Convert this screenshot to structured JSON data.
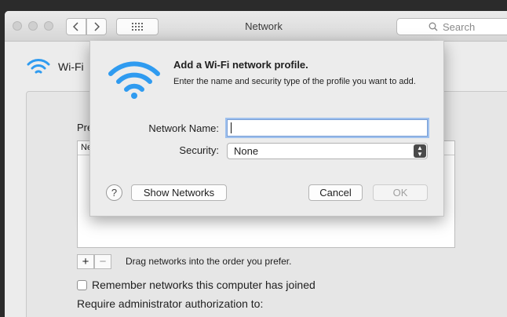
{
  "window": {
    "title": "Network"
  },
  "toolbar": {
    "search_placeholder": "Search"
  },
  "sidebar": {
    "wifi_label": "Wi-Fi"
  },
  "panel": {
    "preferred_label": "Pre",
    "list_header": "Ne",
    "drag_hint": "Drag networks into the order you prefer.",
    "plus_label": "+",
    "minus_label": "−",
    "remember_label": "Remember networks this computer has joined",
    "require_label": "Require administrator authorization to:"
  },
  "dialog": {
    "title": "Add a Wi-Fi network profile.",
    "description": "Enter the name and security type of the profile you want to add.",
    "network_name_label": "Network Name:",
    "network_name_value": "",
    "security_label": "Security:",
    "security_value": "None",
    "help_label": "?",
    "show_networks_label": "Show Networks",
    "cancel_label": "Cancel",
    "ok_label": "OK"
  },
  "colors": {
    "wifi_blue": "#2f9bf0",
    "focus_ring": "#9fc1ee"
  },
  "icons": [
    "wifi-icon",
    "search-icon",
    "back-icon",
    "forward-icon",
    "grid-icon",
    "help-icon"
  ]
}
